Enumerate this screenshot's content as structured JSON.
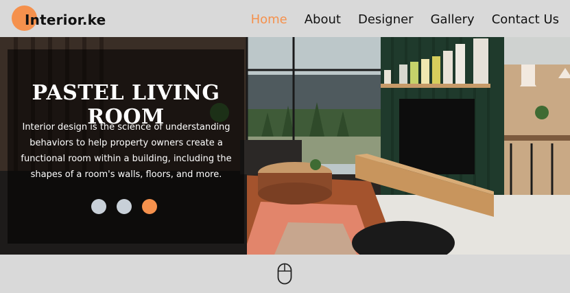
{
  "header": {
    "logo_text": "Interior.ke",
    "nav": [
      "Home",
      "About",
      "Designer",
      "Gallery",
      "Contact Us"
    ],
    "active": "Home"
  },
  "hero": {
    "title": "PASTEL LIVING ROOM",
    "description": "Interior design is the science of understanding behaviors to help property owners create a functional room within a building, including the shapes of a room's walls, floors, and more.",
    "slides": 3,
    "active_slide": 3
  },
  "colors": {
    "accent": "#f5914d",
    "background": "#d9d9d9"
  },
  "icons": [
    "mouse-scroll-icon"
  ]
}
